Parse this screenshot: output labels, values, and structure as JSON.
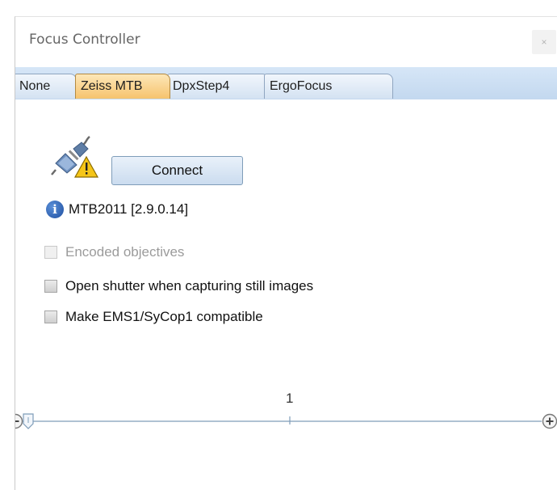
{
  "window": {
    "title": "Focus Controller",
    "close_glyph": "×"
  },
  "tabs": [
    {
      "label": "None",
      "active": false
    },
    {
      "label": "Zeiss MTB",
      "active": true
    },
    {
      "label": "DpxStep4",
      "active": false
    },
    {
      "label": "ErgoFocus",
      "active": false
    }
  ],
  "device": {
    "status_icon": "plug-warning-icon",
    "connect_label": "Connect",
    "info_icon": "info-icon",
    "info_glyph": "i",
    "version_text": "MTB2011 [2.9.0.14]"
  },
  "options": [
    {
      "label": "Encoded objectives",
      "checked": false,
      "enabled": false
    },
    {
      "label": "Open shutter when capturing still images",
      "checked": false,
      "enabled": true
    },
    {
      "label": "Make EMS1/SyCop1 compatible",
      "checked": false,
      "enabled": true
    }
  ],
  "slider": {
    "tick_label": "1",
    "minus_icon": "minus-circle-icon",
    "plus_icon": "plus-circle-icon",
    "thumb_icon": "slider-thumb-icon",
    "value_fraction": 0.0
  },
  "colors": {
    "tab_active": "#f6c36d",
    "tab_strip": "#c3d8ef",
    "info_blue": "#1f4fa0",
    "warning_yellow": "#f5c518"
  }
}
